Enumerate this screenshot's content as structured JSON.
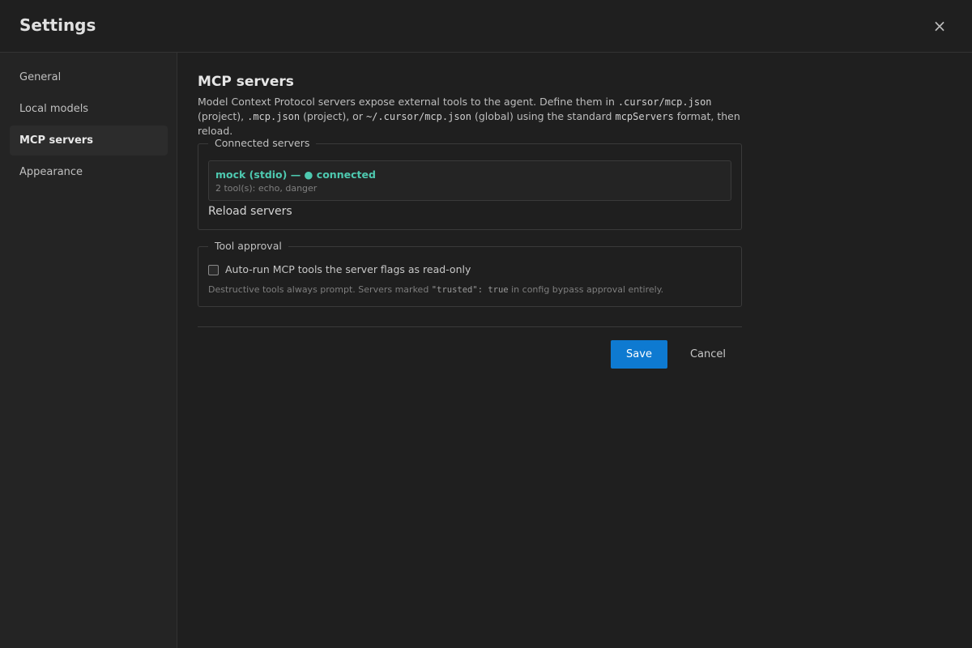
{
  "header": {
    "title": "Settings",
    "close_glyph": "×",
    "close_icon": "close-icon"
  },
  "sidebar": {
    "items": [
      {
        "label": "General",
        "active": false
      },
      {
        "label": "Local models",
        "active": false
      },
      {
        "label": "MCP servers",
        "active": true
      },
      {
        "label": "Appearance",
        "active": false
      }
    ]
  },
  "main": {
    "heading": "MCP servers",
    "description": {
      "t1": "Model Context Protocol servers expose external tools to the agent. Define them in ",
      "c1": ".cursor/mcp.json",
      "t2": " (project), ",
      "c2": ".mcp.json",
      "t3": " (project), or ",
      "c3": "~/.cursor/mcp.json",
      "t4": " (global) using the standard ",
      "c4": "mcpServers",
      "t5": " format, then reload."
    },
    "connected": {
      "legend": "Connected servers",
      "servers": [
        {
          "name": "mock (stdio) — ● connected",
          "tools": "2 tool(s): echo, danger"
        }
      ],
      "reload_label": "Reload servers"
    },
    "approval": {
      "legend": "Tool approval",
      "checkbox_label": "Auto-run MCP tools the server flags as read-only",
      "checked": false,
      "note_t1": "Destructive tools always prompt. Servers marked ",
      "note_c1": "\"trusted\": true",
      "note_t2": " in config bypass approval entirely."
    },
    "actions": {
      "save_label": "Save",
      "cancel_label": "Cancel"
    }
  },
  "colors": {
    "accent": "#0e7ad1",
    "connected": "#4ec9b0",
    "background": "#1f1f1f",
    "sidebar": "#242424"
  }
}
